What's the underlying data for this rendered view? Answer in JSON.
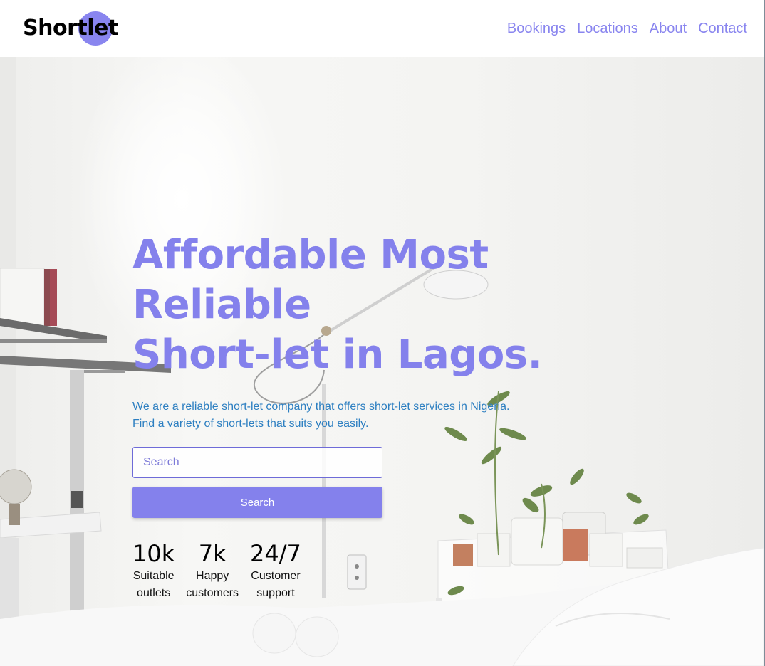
{
  "brand": {
    "logo_text": "Shortlet",
    "accent": "#8985ef"
  },
  "nav": {
    "items": [
      "Bookings",
      "Locations",
      "About",
      "Contact"
    ]
  },
  "hero": {
    "headline_line1": "Affordable Most Reliable",
    "headline_line2": "Short-let in Lagos.",
    "sub_line1": "We are a reliable short-let company that offers short-let services in Nigeria.",
    "sub_line2": "Find a variety of short-lets that suits you easily.",
    "search_placeholder": "Search",
    "search_button": "Search",
    "background": "bedroom-with-lamp-and-plants-photo"
  },
  "stats": [
    {
      "value": "10k",
      "label1": "Suitable",
      "label2": "outlets"
    },
    {
      "value": "7k",
      "label1": "Happy",
      "label2": "customers"
    },
    {
      "value": "24/7",
      "label1": "Customer",
      "label2": "support"
    }
  ]
}
